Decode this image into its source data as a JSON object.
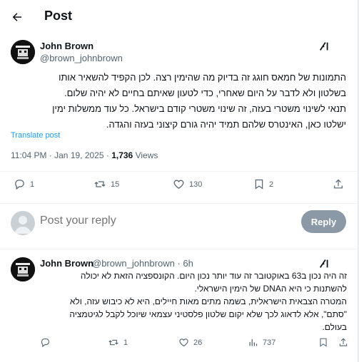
{
  "header": {
    "back_icon": "arrow-left-icon",
    "title": "Post"
  },
  "post": {
    "author_name": "John Brown",
    "author_handle": "@brown_johnbrown",
    "grok_icon": "grok-icon",
    "text_lines": [
      "התמונות של חמאס חוגג זה בדיוק מה שהימין רצה. לכן הקפיד להשאיר אותו",
      "בשלטון ולא לדבר על היום שאחרי, כדי לטעון שאיתם בחיים לא יהיה שלום.",
      "תנאי לשינוי משטרי בעזה, זה שינוי משטרי קודם בישראל. כל עוד ממשלות ימין",
      "ישלטו כאן, האינטרס שלהם תמיד יהיה גורם קיצוני בעזה והגדה."
    ],
    "translate_label": "Translate post",
    "timestamp": "11:04 PM · Jan 19, 2025 · ",
    "views_count": "1,736",
    "views_label": " Views",
    "actions": {
      "replies": "1",
      "reposts": "15",
      "likes": "130",
      "bookmarks": "2"
    }
  },
  "reply_composer": {
    "placeholder": "Post your reply",
    "button_label": "Reply"
  },
  "reply": {
    "author_name": "John Brown",
    "author_handle": "@brown_johnbrown",
    "time_ago": "· 6h",
    "text_lines": [
      "זה היה נכון ב63 באוקטובר זה עוד יותר נכון היום. הקונספציה הזאת לא יכולה",
      "להשתנות כי היא הDNA של הימין הישראלי.",
      "המטרה הצבאית הישראלית, בשמה מתים מאות חיילים, היא לא כיבוש עזה, ולא",
      "\"סתם\", אלא לדאוג לכך שלא יקום שלטון פלסטיני עצמאי שיוכל לקבל לגיטמציה",
      "בעולם."
    ],
    "actions": {
      "replies": "",
      "reposts": "1",
      "likes": "26",
      "views": "737"
    }
  }
}
